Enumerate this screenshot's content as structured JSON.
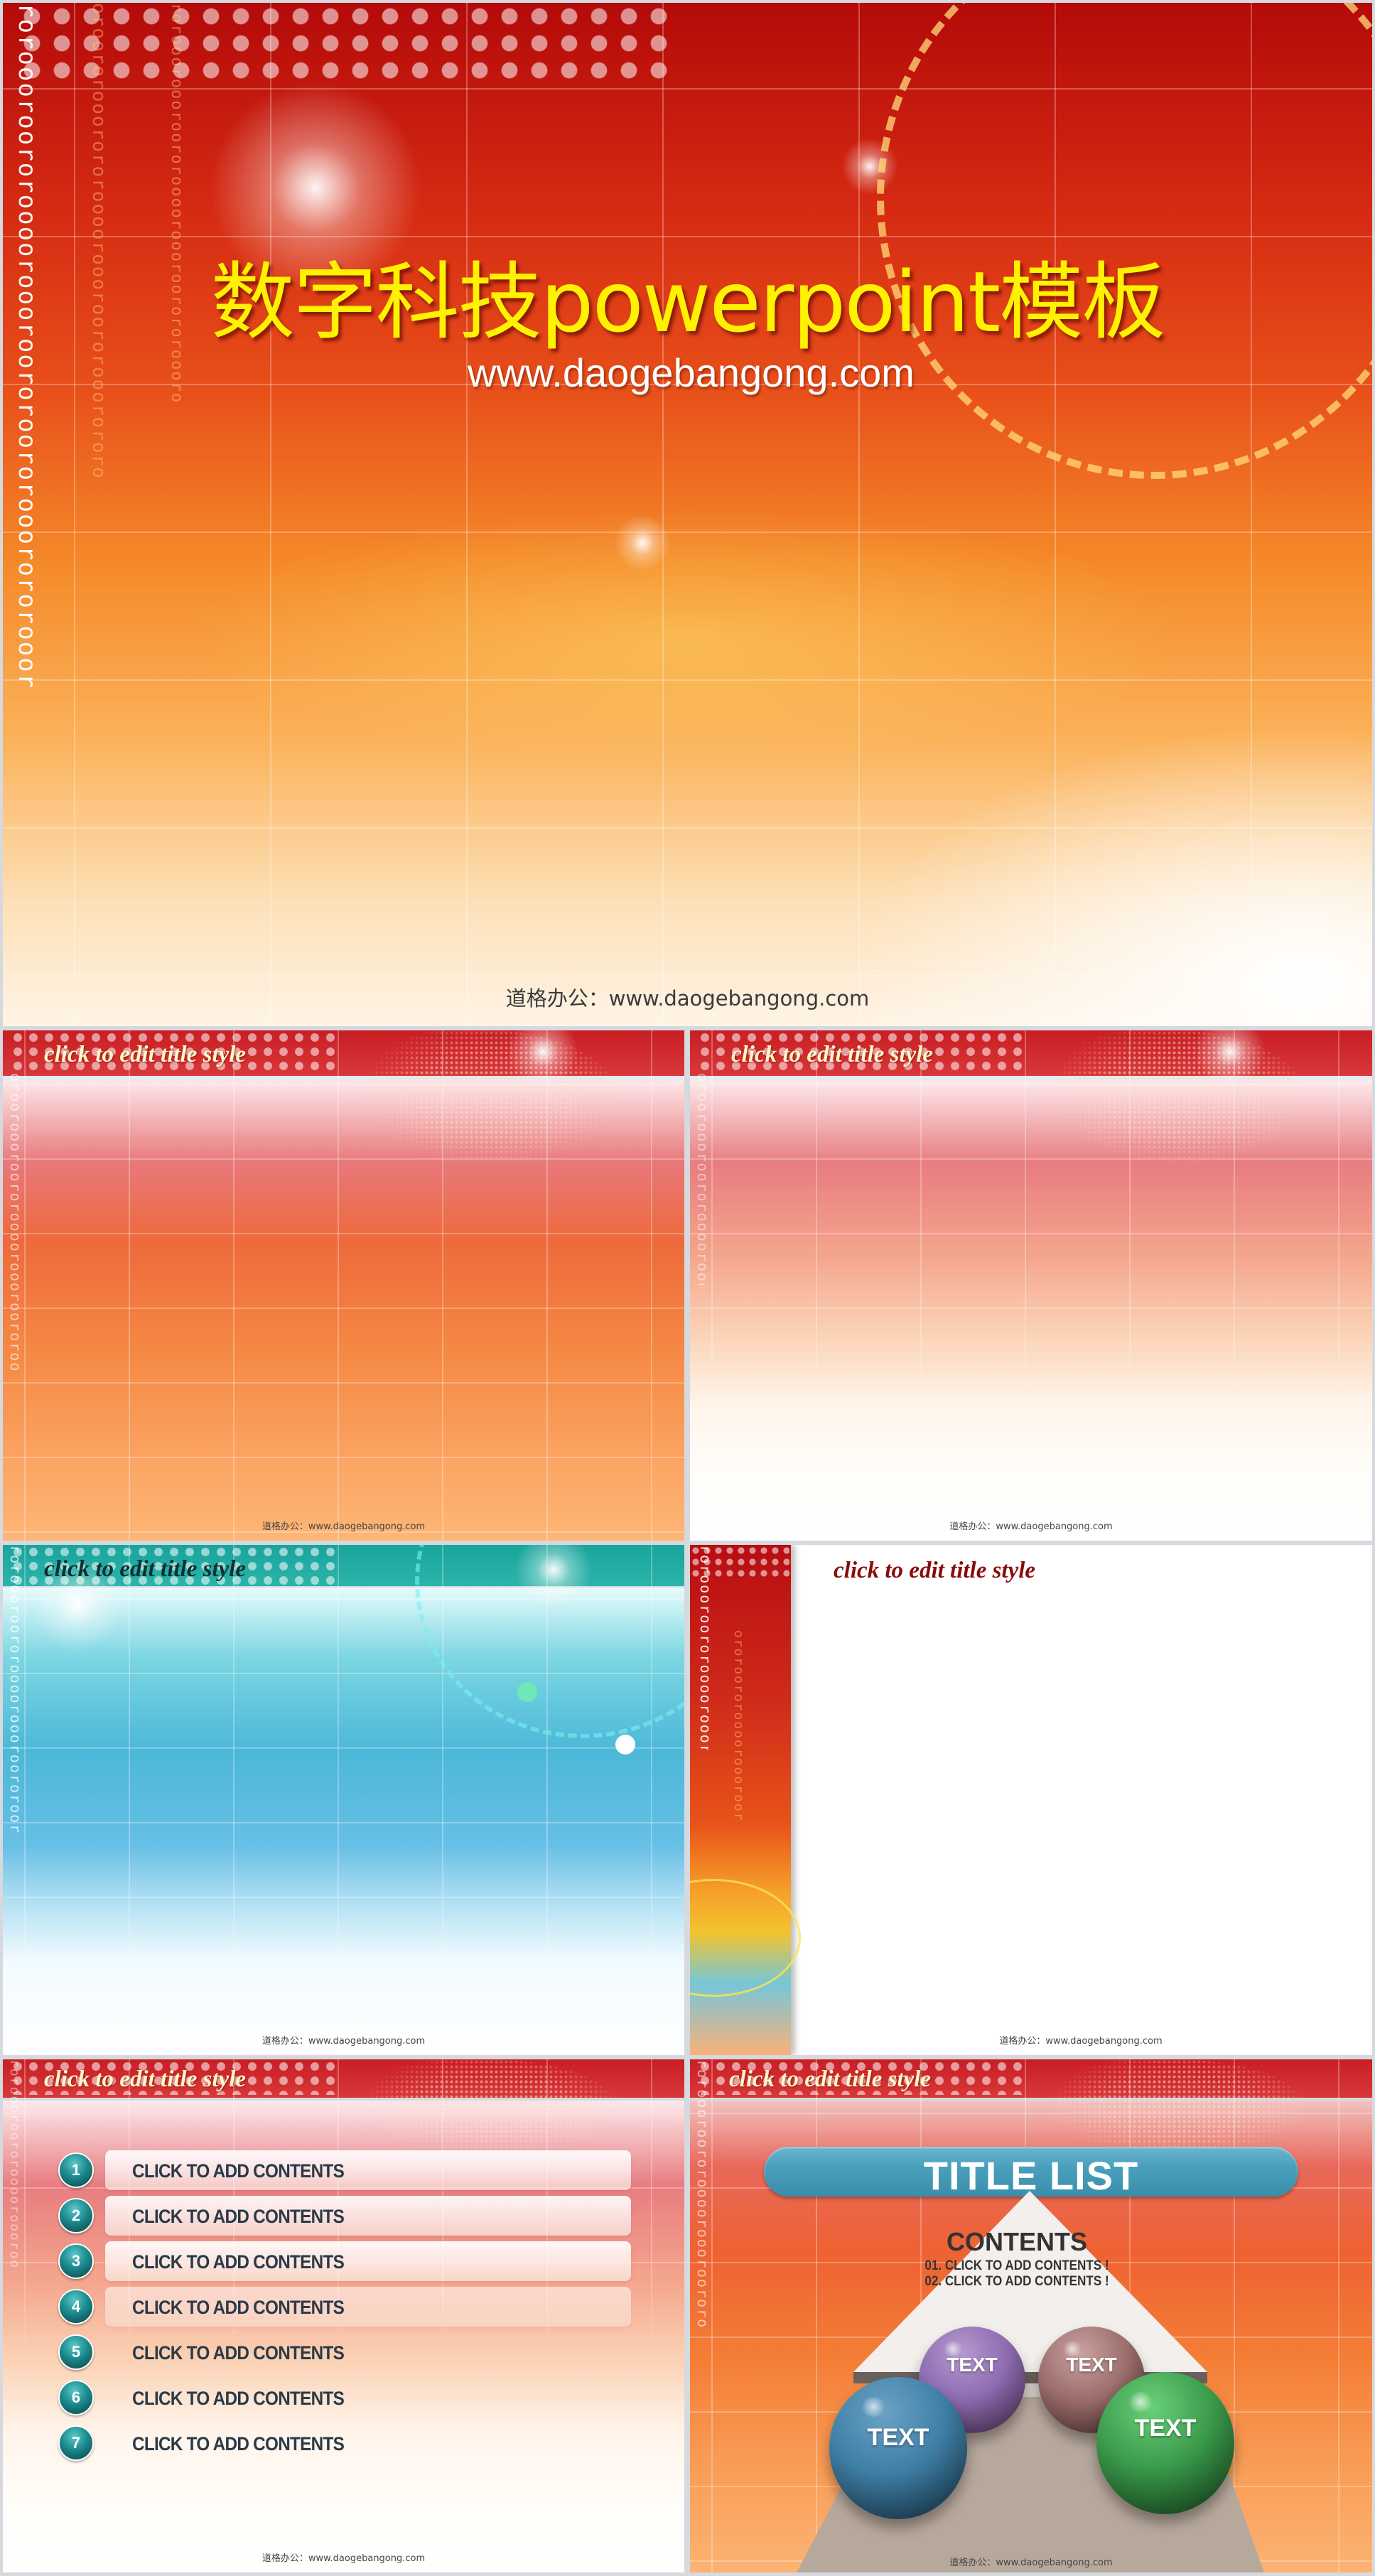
{
  "cover": {
    "title": "数字科技powerpoint模板",
    "subtitle_url": "www.daogebangong.com",
    "footer": "道格办公：www.daogebangong.com"
  },
  "slides": [
    {
      "title": "click to edit title style",
      "footer": "道格办公：www.daogebangong.com",
      "theme": "red-orange"
    },
    {
      "title": "click to edit title style",
      "footer": "道格办公：www.daogebangong.com",
      "theme": "red-fade-white"
    },
    {
      "title": "click to edit title style",
      "footer": "道格办公：www.daogebangong.com",
      "theme": "teal-blue"
    },
    {
      "title": "click to edit title style",
      "footer": "道格办公：www.daogebangong.com",
      "theme": "white-with-side-strip"
    },
    {
      "title": "click to edit title style",
      "footer": "道格办公：www.daogebangong.com",
      "theme": "numbered-list",
      "items": [
        {
          "number": "1",
          "text": "CLICK TO ADD CONTENTS"
        },
        {
          "number": "2",
          "text": "CLICK TO ADD CONTENTS"
        },
        {
          "number": "3",
          "text": "CLICK TO ADD CONTENTS"
        },
        {
          "number": "4",
          "text": "CLICK TO ADD CONTENTS"
        },
        {
          "number": "5",
          "text": "CLICK TO ADD CONTENTS"
        },
        {
          "number": "6",
          "text": "CLICK TO ADD CONTENTS"
        },
        {
          "number": "7",
          "text": "CLICK TO ADD CONTENTS"
        }
      ]
    },
    {
      "title": "click to edit title style",
      "footer": "道格办公：www.daogebangong.com",
      "theme": "title-list-diagram",
      "banner": "TITLE LIST",
      "contents_heading": "CONTENTS",
      "contents_lines": [
        "01. CLICK TO ADD CONTENTS !",
        "02. CLICK TO ADD CONTENTS !"
      ],
      "spheres": [
        {
          "label": "TEXT",
          "color": "#8e6bb0"
        },
        {
          "label": "TEXT",
          "color": "#9c6e6c"
        },
        {
          "label": "TEXT",
          "color": "#3f7fa6"
        },
        {
          "label": "TEXT",
          "color": "#3a9a4a"
        }
      ]
    }
  ],
  "colors": {
    "cover_title": "#fff200",
    "title_light": "#fff8c8",
    "title_dark": "#0e2f33",
    "title_maroon": "#8b0a0a",
    "banner_blue": "#4aa0bc",
    "list_badge_teal": "#1b8b8e"
  }
}
